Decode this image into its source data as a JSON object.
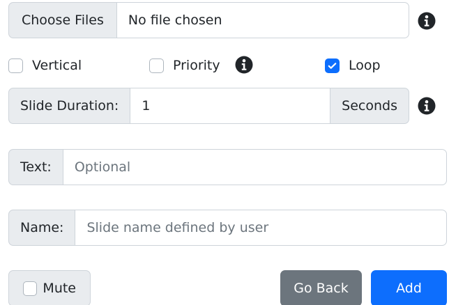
{
  "file": {
    "button_label": "Choose Files",
    "status": "No file chosen"
  },
  "options": {
    "vertical": {
      "label": "Vertical",
      "checked": false
    },
    "priority": {
      "label": "Priority",
      "checked": false
    },
    "loop": {
      "label": "Loop",
      "checked": true
    }
  },
  "duration": {
    "label": "Slide Duration:",
    "value": "1",
    "unit": "Seconds"
  },
  "text_field": {
    "label": "Text:",
    "placeholder": "Optional"
  },
  "name_field": {
    "label": "Name:",
    "placeholder": "Slide name defined by user"
  },
  "mute": {
    "label": "Mute",
    "checked": false
  },
  "actions": {
    "back_label": "Go Back",
    "add_label": "Add"
  },
  "icons": {
    "info": "info-circle-icon",
    "check": "check-icon"
  },
  "colors": {
    "primary": "#0d6efd",
    "secondary": "#6c757d",
    "addon_bg": "#e9ecef",
    "border": "#ced4da"
  }
}
